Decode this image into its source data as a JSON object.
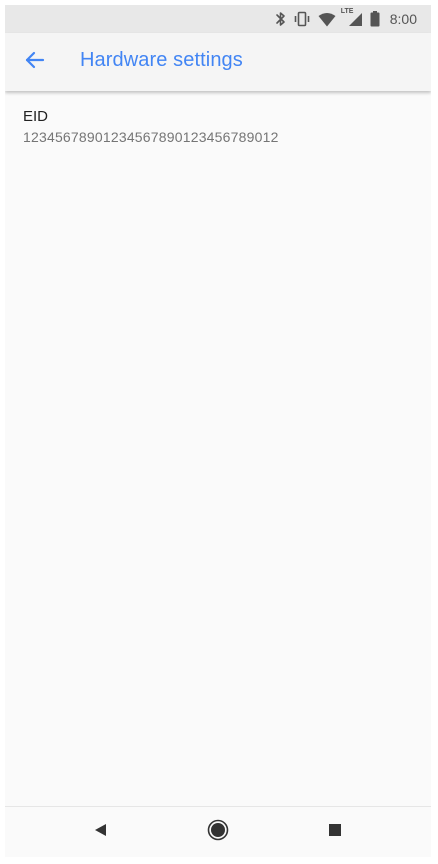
{
  "status_bar": {
    "time": "8:00",
    "icons": [
      "bluetooth-icon",
      "vibrate-icon",
      "wifi-icon",
      "lte-signal-icon",
      "battery-icon"
    ],
    "network_label": "LTE"
  },
  "app_bar": {
    "back_icon": "arrow-back-icon",
    "title": "Hardware settings"
  },
  "preferences": [
    {
      "title": "EID",
      "summary": "12345678901234567890123456789012"
    }
  ],
  "nav_bar": {
    "buttons": [
      "back-triangle-icon",
      "home-circle-icon",
      "recents-square-icon"
    ]
  },
  "colors": {
    "accent": "#4285f4",
    "status_bar_bg": "#e8e8e8",
    "app_bar_bg": "#f5f5f5",
    "content_bg": "#fafafa",
    "icon_gray": "#555555",
    "title_text": "#212121",
    "summary_text": "#757575"
  }
}
